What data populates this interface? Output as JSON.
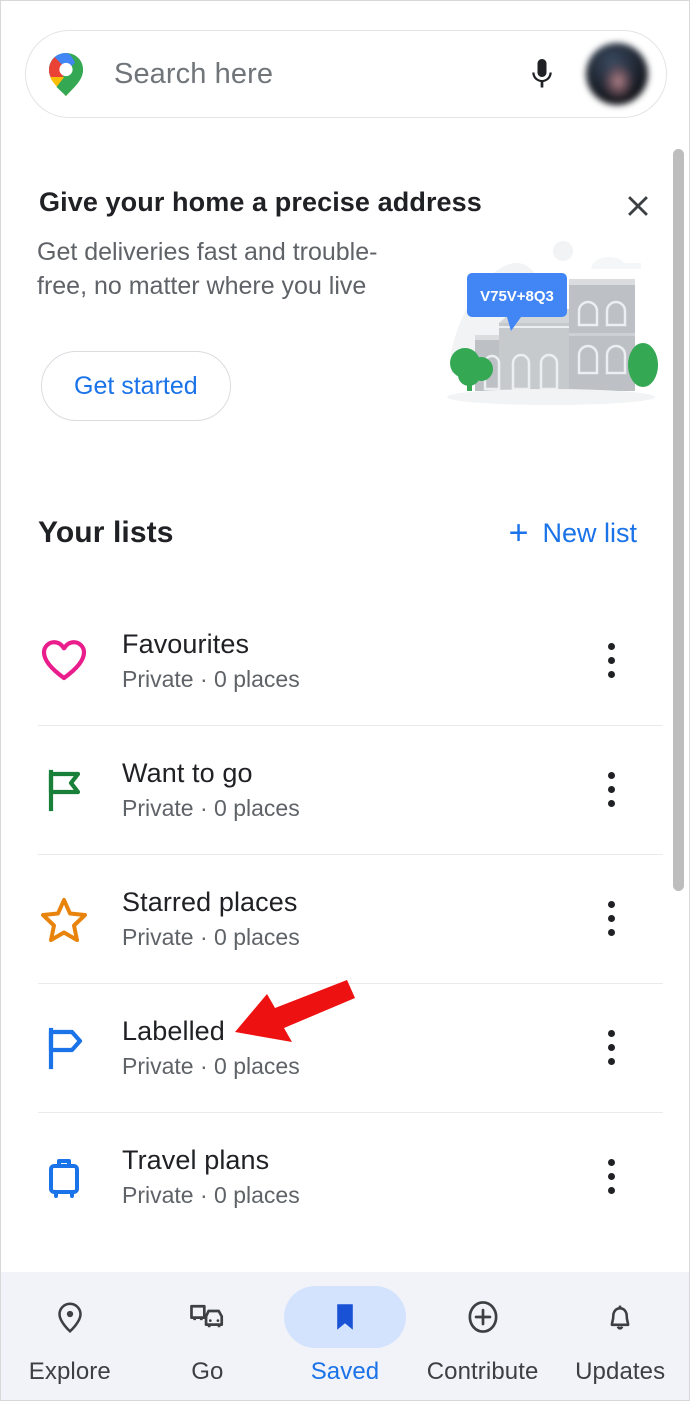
{
  "app": {
    "name": "Google Maps",
    "screen": "Saved"
  },
  "search": {
    "placeholder": "Search here",
    "value": "",
    "logo_icon": "google-maps-pin-icon",
    "mic_icon": "microphone-icon",
    "avatar_icon": "account-avatar"
  },
  "promo": {
    "title": "Give your home a precise address",
    "body": "Get deliveries fast and trouble-free, no matter where you live",
    "cta_label": "Get started",
    "close_icon": "close-icon",
    "illustration": {
      "plus_code": "V75V+8Q3",
      "alt": "houses-with-plus-code-illustration"
    }
  },
  "lists_section": {
    "title": "Your lists",
    "new_list_label": "New list",
    "new_list_plus": "+",
    "items": [
      {
        "name": "Favourites",
        "meta": "Private · 0 places",
        "icon": "heart-icon",
        "color": "#E91E8C",
        "menu_icon": "more-options-icon"
      },
      {
        "name": "Want to go",
        "meta": "Private · 0 places",
        "icon": "flag-icon",
        "color": "#188038",
        "menu_icon": "more-options-icon"
      },
      {
        "name": "Starred places",
        "meta": "Private · 0 places",
        "icon": "star-icon",
        "color": "#E8830C",
        "menu_icon": "more-options-icon"
      },
      {
        "name": "Labelled",
        "meta": "Private · 0 places",
        "icon": "label-flag-icon",
        "color": "#1A73E8",
        "menu_icon": "more-options-icon"
      },
      {
        "name": "Travel plans",
        "meta": "Private · 0 places",
        "icon": "suitcase-icon",
        "color": "#1A73E8",
        "menu_icon": "more-options-icon"
      }
    ]
  },
  "annotation": {
    "type": "red-arrow",
    "points_to": "Labelled",
    "color": "#EE1111"
  },
  "bottom_nav": {
    "active": "Saved",
    "items": [
      {
        "label": "Explore",
        "icon": "map-pin-icon"
      },
      {
        "label": "Go",
        "icon": "commute-icon"
      },
      {
        "label": "Saved",
        "icon": "bookmark-icon"
      },
      {
        "label": "Contribute",
        "icon": "plus-circle-icon"
      },
      {
        "label": "Updates",
        "icon": "bell-icon"
      }
    ]
  },
  "colors": {
    "accent_blue": "#1A73E8",
    "text_primary": "#202124",
    "text_secondary": "#5F6368",
    "nav_background": "#F1F3F9",
    "active_pill": "#D3E3FD"
  }
}
